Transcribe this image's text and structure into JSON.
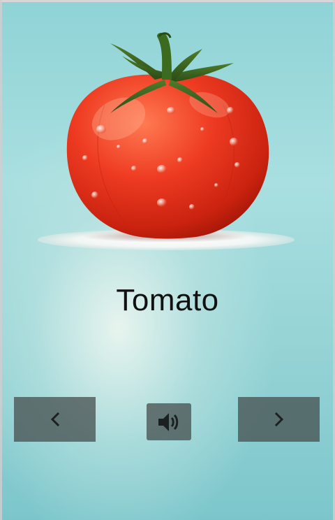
{
  "flashcard": {
    "word": "Tomato",
    "illustration_icon": "tomato-icon"
  },
  "controls": {
    "prev_icon": "chevron-left-icon",
    "sound_icon": "speaker-icon",
    "next_icon": "chevron-right-icon"
  },
  "colors": {
    "button_bg": "#4e5656",
    "tomato_red": "#e83a22"
  }
}
